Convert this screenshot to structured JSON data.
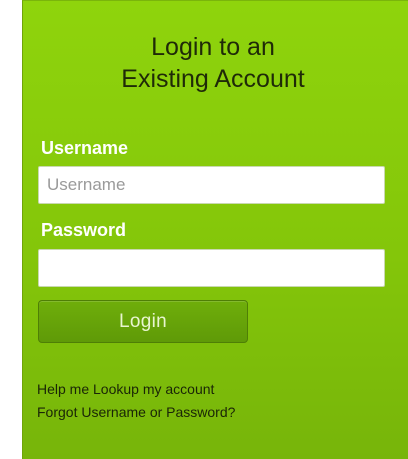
{
  "login_panel": {
    "title_line1": "Login to an",
    "title_line2": "Existing Account",
    "username_label": "Username",
    "username_placeholder": "Username",
    "username_value": "",
    "password_label": "Password",
    "password_value": "",
    "login_button_label": "Login",
    "help_lookup_link": "Help me Lookup my account",
    "forgot_link": "Forgot Username or Password?"
  },
  "colors": {
    "panel_green": "#84c60a",
    "button_green": "#6fae0a",
    "label_white": "#ffffff"
  }
}
